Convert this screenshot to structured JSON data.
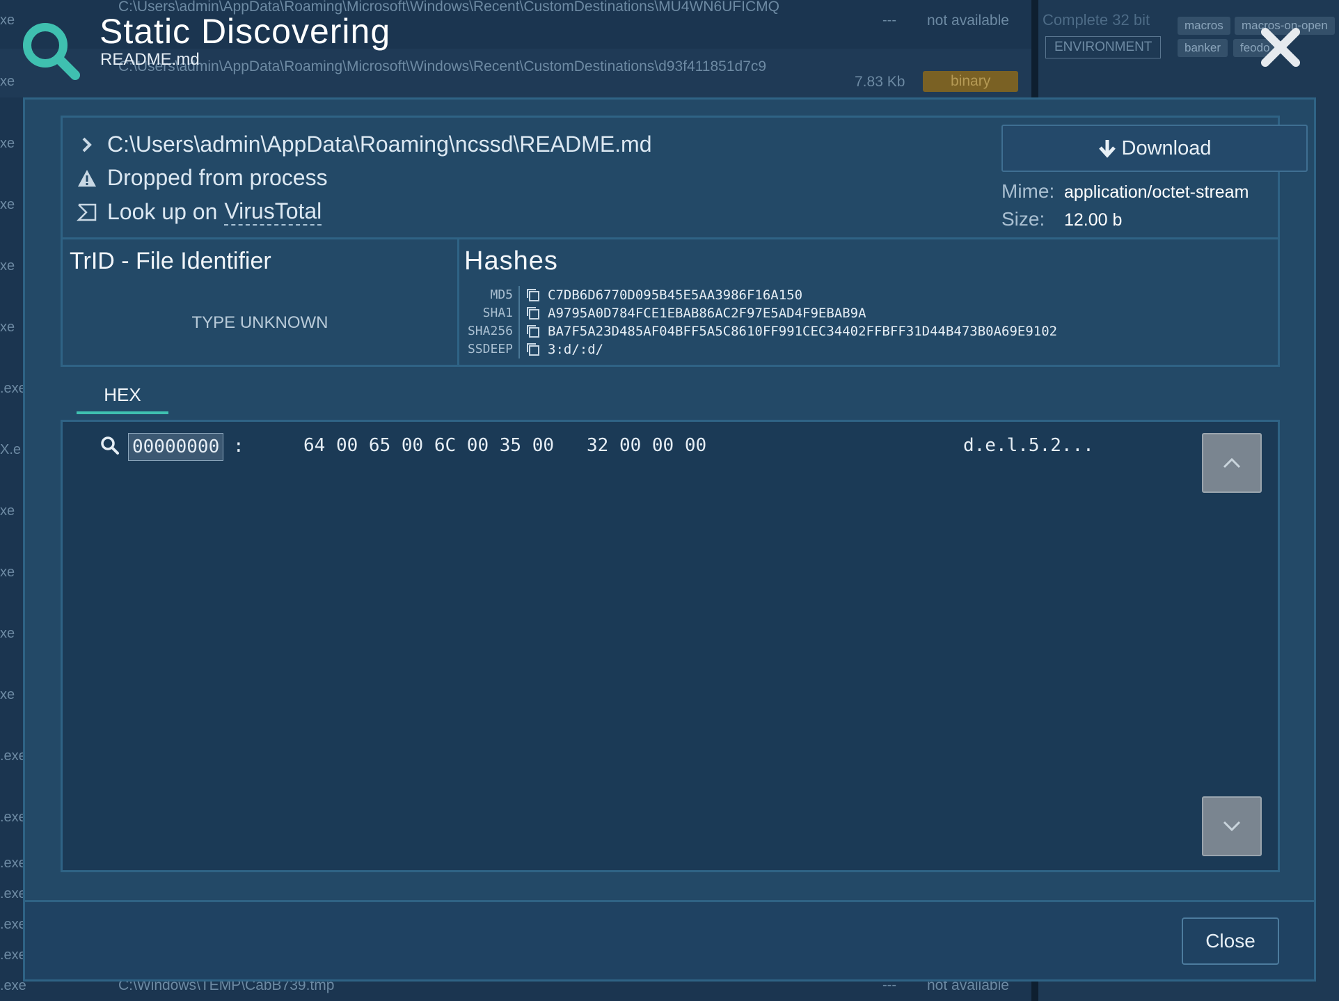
{
  "background": {
    "rows": [
      {
        "path": "C:\\Users\\admin\\AppData\\Roaming\\Microsoft\\Windows\\Recent\\CustomDestinations\\MU4WN6UFICMQ",
        "dash": "---",
        "status": "not available"
      },
      {
        "path": "C:\\Users\\admin\\AppData\\Roaming\\Microsoft\\Windows\\Recent\\CustomDestinations\\d93f411851d7c9",
        "size": "7.83 Kb",
        "badge": "binary"
      },
      {
        "path": "C:\\Windows\\TEMP\\CabB739.tmp",
        "dash": "---",
        "status": "not available"
      }
    ],
    "rail_labels": [
      "xe",
      "xe",
      "xe",
      "xe",
      "xe",
      "xe",
      ".exe",
      "X.e",
      "xe",
      "xe",
      "xe",
      "xe",
      ".exe",
      ".exe",
      ".exe",
      ".exe",
      ".exe",
      ".exe",
      ".exe"
    ],
    "environment": "ENVIRONMENT",
    "complete": "Complete 32 bit",
    "tags": [
      "macros",
      "macros-on-open",
      "banker",
      "feodo"
    ]
  },
  "header": {
    "title": "Static Discovering",
    "subtitle": "README.md"
  },
  "file": {
    "path": "C:\\Users\\admin\\AppData\\Roaming\\ncssd\\README.md",
    "dropped_label": "Dropped from process",
    "lookup_prefix": "Look up on",
    "lookup_link": "VirusTotal",
    "download_label": "Download",
    "mime_label": "Mime:",
    "mime_value": "application/octet-stream",
    "size_label": "Size:",
    "size_value": "12.00 b"
  },
  "trid": {
    "title": "TrID - File Identifier",
    "type": "TYPE UNKNOWN"
  },
  "hashes": {
    "title": "Hashes",
    "rows": [
      {
        "label": "MD5",
        "value": "C7DB6D6770D095B45E5AA3986F16A150"
      },
      {
        "label": "SHA1",
        "value": "A9795A0D784FCE1EBAB86AC2F97E5AD4F9EBAB9A"
      },
      {
        "label": "SHA256",
        "value": "BA7F5A23D485AF04BFF5A5C8610FF991CEC34402FFBFF31D44B473B0A69E9102"
      },
      {
        "label": "SSDEEP",
        "value": "3:d/:d/"
      }
    ]
  },
  "tabs": {
    "hex_label": "HEX"
  },
  "hex": {
    "offset": "00000000",
    "colon": ":",
    "bytes": "64 00 65 00 6C 00 35 00   32 00 00 00",
    "ascii": "d.e.l.5.2..."
  },
  "footer": {
    "close_label": "Close"
  },
  "colors": {
    "accent": "#3fc0b0",
    "modal_bg": "#234967",
    "hex_bg": "#1b3a56"
  }
}
